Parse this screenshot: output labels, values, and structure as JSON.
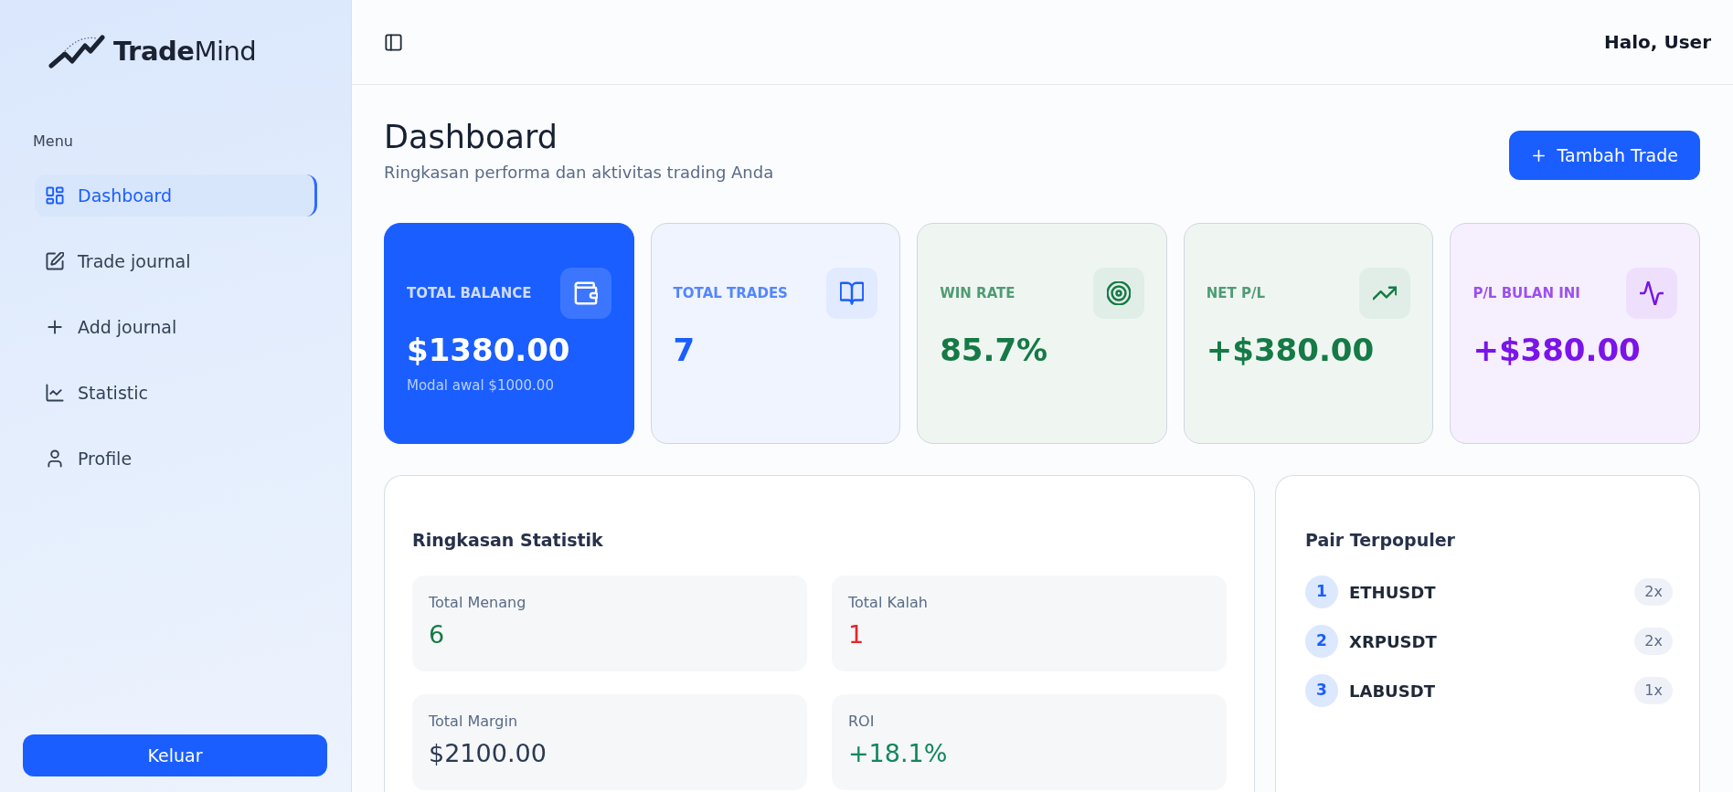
{
  "sidebar": {
    "logo": "**Trade**Mind",
    "menu_heading": "Menu",
    "items": [
      {
        "label": "Dashboard",
        "selected": true
      },
      {
        "label": "Trade journal",
        "selected": false
      },
      {
        "label": "Add journal",
        "selected": false
      },
      {
        "label": "Statistic",
        "selected": false
      },
      {
        "label": "Profile",
        "selected": false
      }
    ],
    "logout_button": "Keluar"
  },
  "topbar": {
    "greeting": "Halo, User"
  },
  "header": {
    "title": "Dashboard",
    "subtitle": "Ringkasan performa dan aktivitas trading Anda",
    "add_button": "Tambah Trade"
  },
  "stat_cards": [
    {
      "kind": "solid",
      "color": "#1a5eff",
      "label": "TOTAL BALANCE",
      "value": "$1380.00",
      "note": "Modal awal $1000.00"
    },
    {
      "kind": "tinted",
      "color": "#1a5eff",
      "label": "TOTAL TRADES",
      "value": "7"
    },
    {
      "kind": "tinted",
      "color": "#157a45",
      "label": "WIN RATE",
      "value": "85.7%"
    },
    {
      "kind": "tinted",
      "color": "#157a45",
      "label": "NET P/L",
      "value": "+$380.00"
    },
    {
      "kind": "tinted",
      "color": "#7a14e8",
      "label": "P/L BULAN INI",
      "value": "+$380.00"
    }
  ],
  "summary": {
    "title": "Ringkasan Statistik",
    "tiles": [
      {
        "label": "Total Menang",
        "value": "6",
        "color": "#157a45"
      },
      {
        "label": "Total Kalah",
        "value": "1",
        "color": "#e5262b"
      },
      {
        "label": "Total Margin",
        "value": "$2100.00",
        "color": "#2b3a52"
      },
      {
        "label": "ROI",
        "value": "+18.1%",
        "color": "#12875a"
      }
    ]
  },
  "popular_pairs": {
    "title": "Pair Terpopuler",
    "items": [
      {
        "rank": "1",
        "pair": "ETHUSDT",
        "count": "2x"
      },
      {
        "rank": "2",
        "pair": "XRPUSDT",
        "count": "2x"
      },
      {
        "rank": "3",
        "pair": "LABUSDT",
        "count": "1x"
      }
    ]
  }
}
